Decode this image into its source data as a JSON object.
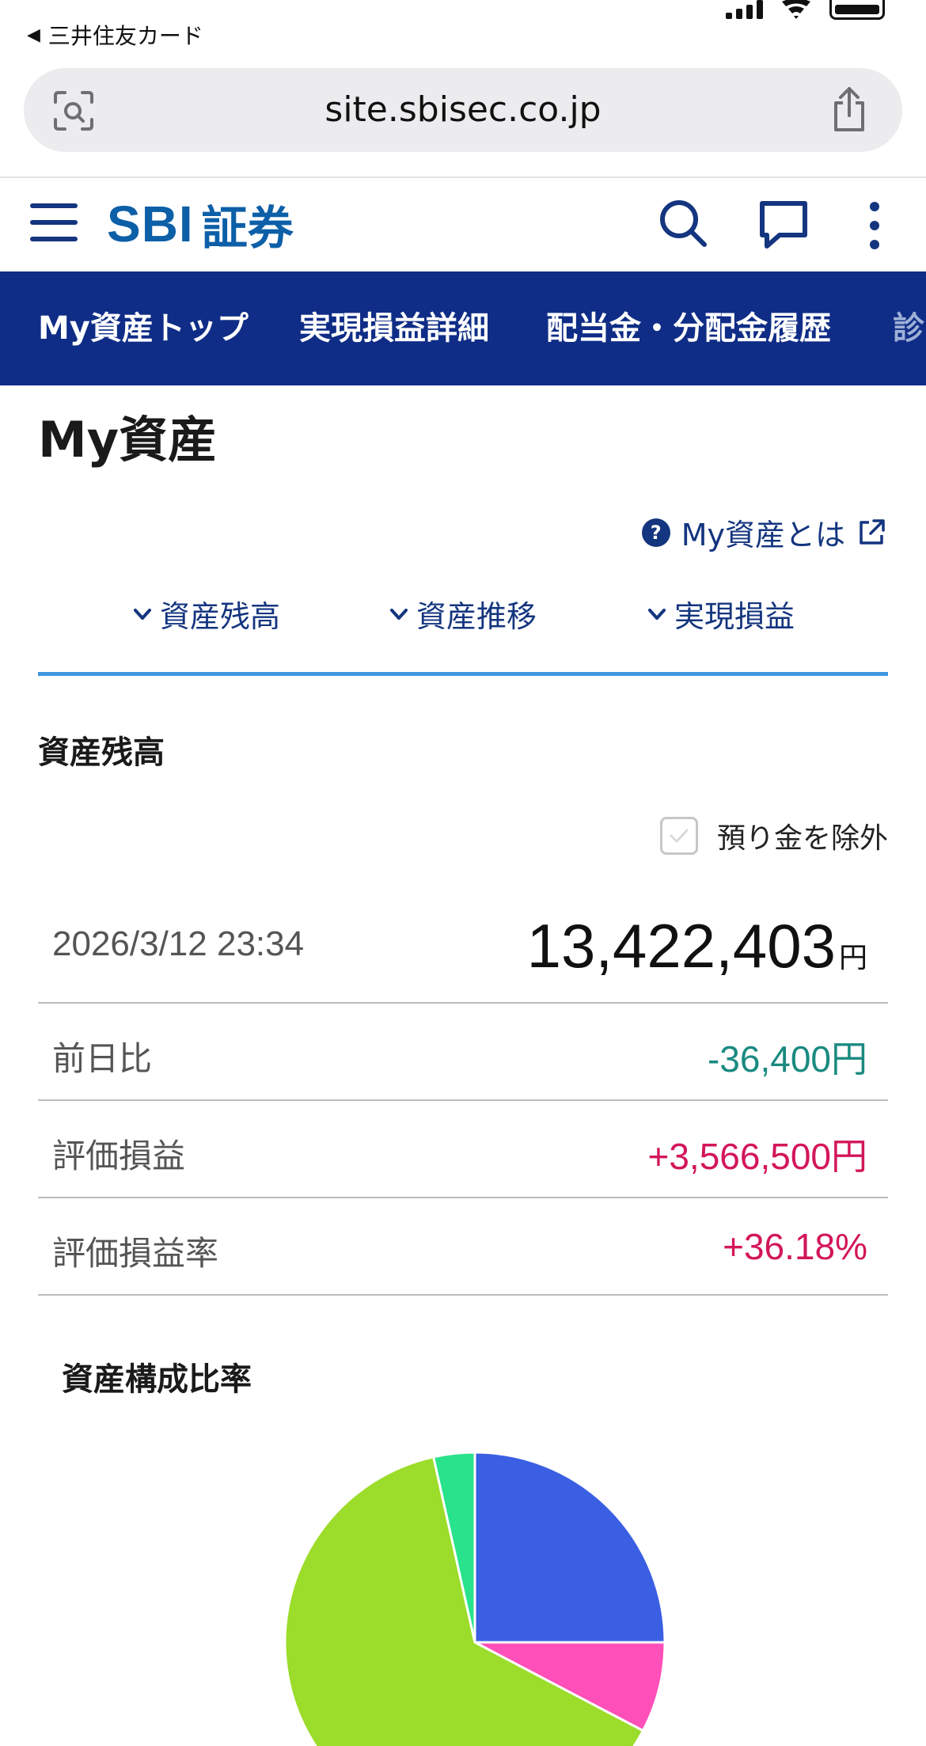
{
  "status_bar": {
    "back_app": "三井住友カード"
  },
  "browser": {
    "url": "site.sbisec.co.jp"
  },
  "header": {
    "logo_latin": "SBI",
    "logo_ja": "証券"
  },
  "nav": {
    "items": [
      "My資産トップ",
      "実現損益詳細",
      "配当金・分配金履歴",
      "診"
    ]
  },
  "page": {
    "title": "My資産",
    "help_link": "My資産とは",
    "anchor_tabs": [
      "資産残高",
      "資産推移",
      "実現損益"
    ]
  },
  "balance": {
    "section_title": "資産残高",
    "exclude_deposit_label": "預り金を除外",
    "exclude_deposit_checked": false,
    "timestamp": "2026/3/12 23:34",
    "total_value": "13,422,403",
    "total_unit": "円",
    "rows": [
      {
        "label": "前日比",
        "value": "-36,400円",
        "tone": "negative"
      },
      {
        "label": "評価損益",
        "value": "+3,566,500円",
        "tone": "positive"
      },
      {
        "label": "評価損益率",
        "value": "+36.18%",
        "tone": "positive"
      }
    ]
  },
  "composition": {
    "title": "資産構成比率",
    "slice_shares_percent": [
      25.0,
      7.7,
      63.8,
      3.5
    ],
    "slice_colors": [
      "#3b5fe3",
      "#ff4fb8",
      "#9cdc2a",
      "#28e28c"
    ]
  }
}
